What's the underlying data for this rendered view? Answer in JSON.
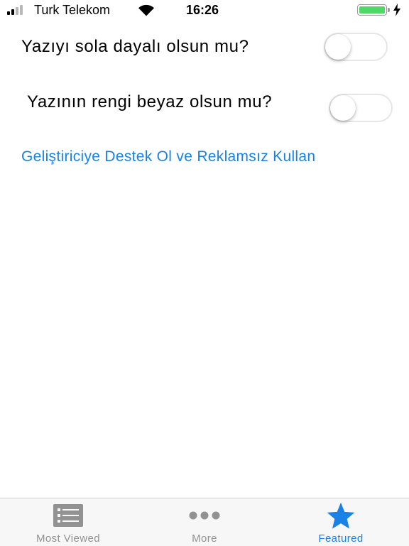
{
  "status_bar": {
    "carrier": "Turk Telekom",
    "time": "16:26",
    "signal_bars_filled": 2,
    "signal_bars_total": 4,
    "battery_level": 1.0
  },
  "settings": {
    "align_left": {
      "label": "Yazıyı sola dayalı olsun mu?",
      "enabled": false
    },
    "white_text": {
      "label": "Yazının rengi beyaz olsun mu?",
      "enabled": false
    }
  },
  "support_link": {
    "label": "Geliştiriciye Destek Ol ve Reklamsız Kullan"
  },
  "tab_bar": {
    "tabs": [
      {
        "label": "Most Viewed",
        "icon": "list-icon",
        "active": false
      },
      {
        "label": "More",
        "icon": "ellipsis-icon",
        "active": false
      },
      {
        "label": "Featured",
        "icon": "star-icon",
        "active": true
      }
    ]
  },
  "colors": {
    "accent": "#1a82e5",
    "inactive_tab": "#929292",
    "battery": "#4cd964"
  }
}
